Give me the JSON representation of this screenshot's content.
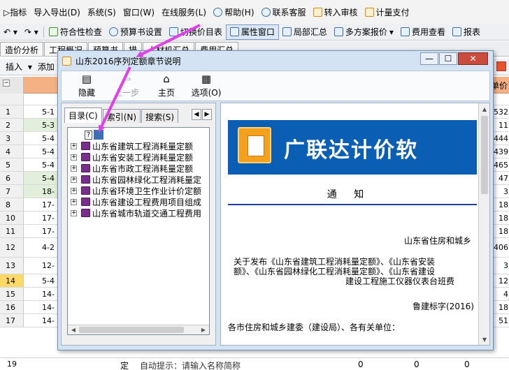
{
  "menubar": {
    "items": [
      "▷指标",
      "导入导出(D)",
      "系统(S)",
      "窗口(W)",
      "在线服务(L)",
      "帮助(H)",
      "联系客服",
      "转入审核",
      "计量支付"
    ]
  },
  "toolbar": {
    "items": [
      "符合性检查",
      "预算书设置",
      "切换价目表",
      "属性窗口",
      "局部汇总",
      "多方案报价",
      "费用查看",
      "报表"
    ]
  },
  "tabs": [
    "造价分析",
    "工程概况",
    "预算书",
    "措",
    "人材机汇总",
    "费用汇总"
  ],
  "subbar": {
    "insert_label": "插入",
    "add_label": "添加"
  },
  "grid": {
    "head_right": "单价",
    "rows": [
      {
        "num": "1",
        "code": "5-1",
        "val": "532"
      },
      {
        "num": "2",
        "code": "5-3",
        "val": "11"
      },
      {
        "num": "3",
        "code": "5-4",
        "val": "444"
      },
      {
        "num": "4",
        "code": "5-4",
        "val": "439"
      },
      {
        "num": "5",
        "code": "5-4",
        "val": "465"
      },
      {
        "num": "6",
        "code": "5-4",
        "val": "47"
      },
      {
        "num": "7",
        "code": "18-",
        "val": "3"
      },
      {
        "num": "8",
        "code": "17-",
        "val": "18"
      },
      {
        "num": "10",
        "code": "17-",
        "val": "18"
      },
      {
        "num": "11",
        "code": "17-",
        "val": "18"
      },
      {
        "num": "12",
        "code": "4-2",
        "val": "406"
      },
      {
        "num": "13",
        "code": "12-",
        "val": "3"
      },
      {
        "num": "14",
        "code": "5-4",
        "val": "12"
      },
      {
        "num": "15",
        "code": "14-",
        "val": "4"
      },
      {
        "num": "16",
        "code": "14-",
        "val": "18"
      },
      {
        "num": "17",
        "code": "14-",
        "val": "51"
      }
    ],
    "bottom": {
      "num": "19",
      "type": "定",
      "hint": "自动提示：请输入名称简称",
      "v1": "0",
      "v2": "0",
      "v3": "0"
    }
  },
  "dialog": {
    "title": "山东2016序列定额章节说明",
    "window_buttons": {
      "minimize": "—",
      "maximize": "☐",
      "close": "✕"
    },
    "toolbar": [
      {
        "label": "隐藏",
        "glyph": "▤"
      },
      {
        "label": "上一步",
        "glyph": "⇦"
      },
      {
        "label": "主页",
        "glyph": "⌂"
      },
      {
        "label": "选项(O)",
        "glyph": "▦"
      }
    ],
    "left_tabs": [
      "目录(C)",
      "索引(N)",
      "搜索(S)"
    ],
    "tree": [
      "山东省建筑工程消耗量定额",
      "山东省安装工程消耗量定额",
      "山东省市政工程消耗量定额",
      "山东省园林绿化工程消耗量定",
      "山东省环境卫生作业计价定额",
      "山东省建设工程费用项目组成",
      "山东省城市轨道交通工程费用"
    ],
    "doc": {
      "banner_text": "广联达计价软",
      "notice_title": "通 知",
      "issuer": "山东省住房和城乡",
      "line1": "关于发布《山东省建筑工程消耗量定额》、《山东省安装",
      "line2": "额》、《山东省园林绿化工程消耗量定额》、《山东省建设",
      "line3": "建设工程施工仪器仪表台班费",
      "doc_number": "鲁建标字(2016)",
      "recipients": "各市住房和城乡建委（建设局）、各有关单位："
    }
  },
  "colors": {
    "arrow": "#e040e8",
    "grid_head": "#f4b183",
    "green_row": "#e2efda",
    "banner": "#0a5fb4"
  }
}
